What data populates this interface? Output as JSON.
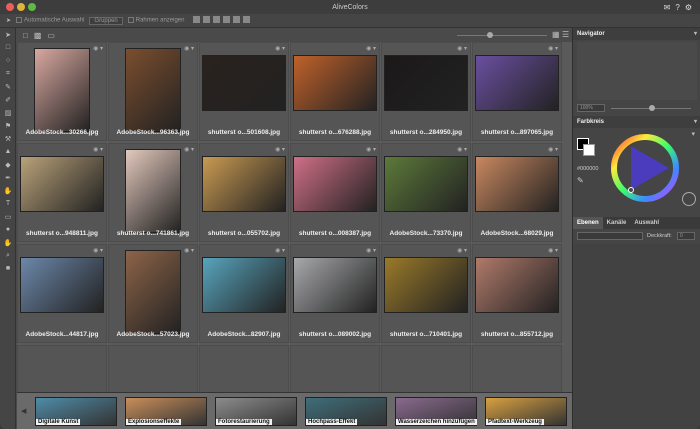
{
  "app": {
    "title": "AliveColors"
  },
  "options": {
    "auto_select": "Automatische Auswahl",
    "groups": "Gruppen",
    "show_frames": "Rahmen anzeigen"
  },
  "title_icons": [
    "message-icon",
    "help-icon",
    "gear-icon"
  ],
  "tools": [
    "pointer",
    "marquee",
    "lasso",
    "crop",
    "eyedropper",
    "brush",
    "eraser",
    "stamp",
    "stamp2",
    "drop",
    "fill",
    "pen",
    "smudge",
    "text",
    "shape",
    "blur",
    "hand",
    "zoom",
    "colors"
  ],
  "files": [
    {
      "name": "AdobeStock...30266.jpg",
      "color": "#d9a8a0",
      "w": 56,
      "h": 84
    },
    {
      "name": "AdobeStock...96363.jpg",
      "color": "#7b4e2e",
      "w": 56,
      "h": 84
    },
    {
      "name": "shutterst o...501608.jpg",
      "color": "#2a221e",
      "w": 84,
      "h": 56
    },
    {
      "name": "shutterst o...676288.jpg",
      "color": "#c0612a",
      "w": 84,
      "h": 56
    },
    {
      "name": "shutterst o...284950.jpg",
      "color": "#1b1818",
      "w": 84,
      "h": 56
    },
    {
      "name": "shutterst o...897065.jpg",
      "color": "#6a4fa0",
      "w": 84,
      "h": 56
    },
    {
      "name": "shutterst o...948811.jpg",
      "color": "#b9a27a",
      "w": 84,
      "h": 56
    },
    {
      "name": "shutterst o...741861.jpg",
      "color": "#e3c9bd",
      "w": 56,
      "h": 84
    },
    {
      "name": "shutterst o...055702.jpg",
      "color": "#c99a52",
      "w": 84,
      "h": 56
    },
    {
      "name": "shutterst o...008387.jpg",
      "color": "#cf6f86",
      "w": 84,
      "h": 56
    },
    {
      "name": "AdobeStock...73370.jpg",
      "color": "#5c7a3a",
      "w": 84,
      "h": 56
    },
    {
      "name": "AdobeStock...68029.jpg",
      "color": "#c9885f",
      "w": 84,
      "h": 56
    },
    {
      "name": "AdobeStock...44817.jpg",
      "color": "#6c88aa",
      "w": 84,
      "h": 56
    },
    {
      "name": "AdobeStock...57023.jpg",
      "color": "#8d6448",
      "w": 56,
      "h": 84
    },
    {
      "name": "AdobeStock...82907.jpg",
      "color": "#58a4bd",
      "w": 84,
      "h": 56
    },
    {
      "name": "shutterst o...089002.jpg",
      "color": "#a8a9ab",
      "w": 84,
      "h": 56
    },
    {
      "name": "shutterst o...710401.jpg",
      "color": "#9a7a2a",
      "w": 84,
      "h": 56
    },
    {
      "name": "shutterst o...855712.jpg",
      "color": "#b07a6a",
      "w": 84,
      "h": 56
    }
  ],
  "strip": [
    {
      "label": "Digitale Kunst",
      "color": "#4f8ca8"
    },
    {
      "label": "Explosionseffekte",
      "color": "#c98e5a"
    },
    {
      "label": "Fotorestaurierung",
      "color": "#8c8c8c"
    },
    {
      "label": "Hochpass-Effekt",
      "color": "#3f6e7a"
    },
    {
      "label": "Wasserzeichen hinzufügen",
      "color": "#8a6a8f"
    },
    {
      "label": "Pfadtext-Werkzeug",
      "color": "#d8a040"
    }
  ],
  "panel": {
    "navigator": "Navigator",
    "zoom": "100%",
    "color_wheel": "Farbkreis",
    "hex": "#000000",
    "tabs": [
      "Ebenen",
      "Kanäle",
      "Auswahl"
    ],
    "opacity_label": "Deckkraft:",
    "opacity_value": "0"
  }
}
